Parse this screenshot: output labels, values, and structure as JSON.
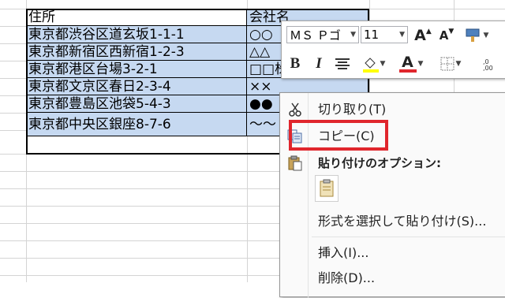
{
  "sheet": {
    "header": [
      "住所",
      "会社名"
    ],
    "rows": [
      [
        "東京都渋谷区道玄坂1-1-1",
        "○○"
      ],
      [
        "東京都新宿区西新宿1-2-3",
        "△△"
      ],
      [
        "東京都港区台場3-2-1",
        "□□株式会社"
      ],
      [
        "東京都文京区春日2-3-4",
        "××"
      ],
      [
        "東京都豊島区池袋5-4-3",
        "●●"
      ],
      [
        "東京都中央区銀座8-7-6",
        "～～"
      ]
    ]
  },
  "mini_toolbar": {
    "font_name": "ＭＳ Ｐゴ",
    "font_size": "11",
    "grow_font": "A",
    "shrink_font": "A",
    "bold": "B",
    "italic": "I",
    "font_color_letter": "A",
    "font_color": "#e0262d",
    "fill_color": "#ffff00"
  },
  "context_menu": {
    "items": [
      {
        "label": "切り取り(T)",
        "icon": "scissors-icon"
      },
      {
        "label": "コピー(C)",
        "icon": "copy-icon"
      },
      {
        "label": "貼り付けのオプション:",
        "icon": "paste-icon"
      },
      {
        "label": "形式を選択して貼り付け(S)...",
        "icon": ""
      },
      {
        "label": "挿入(I)...",
        "icon": ""
      },
      {
        "label": "削除(D)...",
        "icon": ""
      }
    ],
    "highlight_color": "#e0262d"
  }
}
